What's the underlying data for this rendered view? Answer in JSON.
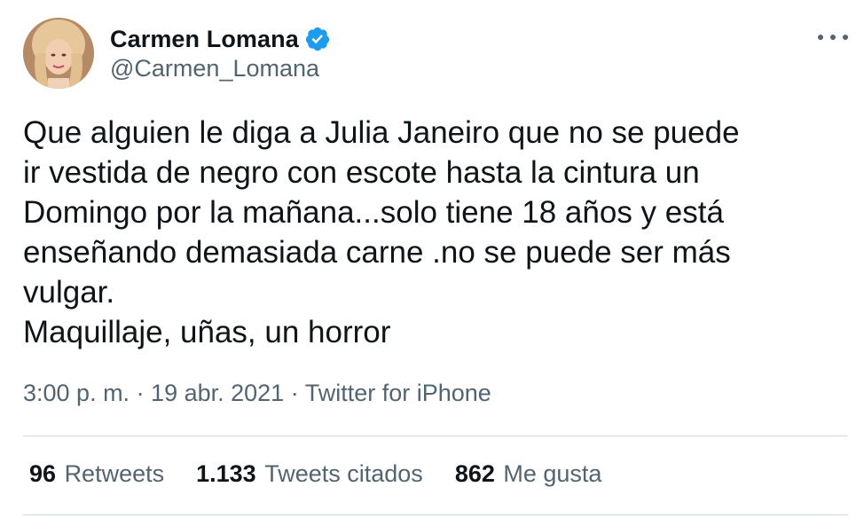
{
  "author": {
    "display_name": "Carmen Lomana",
    "handle": "@Carmen_Lomana",
    "verified": true,
    "avatar_icon": "profile-photo"
  },
  "tweet": {
    "lines": [
      "Que alguien le diga a Julia Janeiro que no se puede",
      "ir vestida de negro con escote hasta la cintura un",
      "Domingo por la mañana...solo tiene 18 años y está",
      "enseñando demasiada carne .no se puede ser más",
      "vulgar.",
      "Maquillaje, uñas, un horror"
    ],
    "meta": "3:00 p. m. · 19 abr. 2021 · Twitter for iPhone"
  },
  "stats": {
    "retweets": {
      "count": "96",
      "label": "Retweets"
    },
    "quotes": {
      "count": "1.133",
      "label": "Tweets citados"
    },
    "likes": {
      "count": "862",
      "label": "Me gusta"
    }
  },
  "colors": {
    "text": "#0f1419",
    "secondary": "#536471",
    "verified": "#1d9bf0",
    "divider": "#cfd9de"
  },
  "icons": {
    "more": "more-horizontal-icon",
    "verified": "verified-badge-icon"
  }
}
